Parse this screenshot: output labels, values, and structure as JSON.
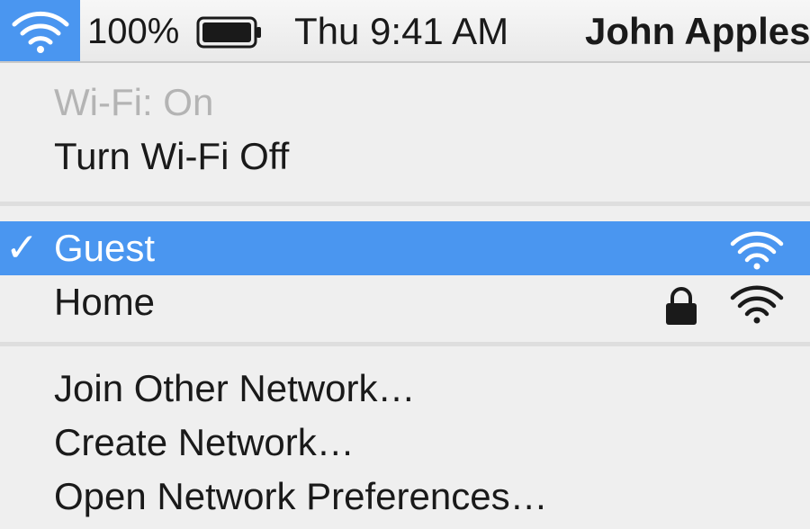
{
  "menubar": {
    "wifi_icon": "wifi-icon",
    "battery_percent": "100%",
    "battery_icon": "battery-full-icon",
    "clock": "Thu 9:41 AM",
    "user": "John Apples",
    "accent_color": "#4a96f0"
  },
  "wifi_menu": {
    "status": "Wi-Fi: On",
    "toggle": "Turn Wi-Fi Off",
    "networks": [
      {
        "name": "Guest",
        "selected": true,
        "check": "✓",
        "locked": false,
        "signal_icon": "wifi-signal-icon"
      },
      {
        "name": "Home",
        "selected": false,
        "locked": true,
        "lock_icon": "lock-icon",
        "signal_icon": "wifi-signal-icon"
      }
    ],
    "actions": [
      "Join Other Network…",
      "Create Network…",
      "Open Network Preferences…"
    ]
  }
}
